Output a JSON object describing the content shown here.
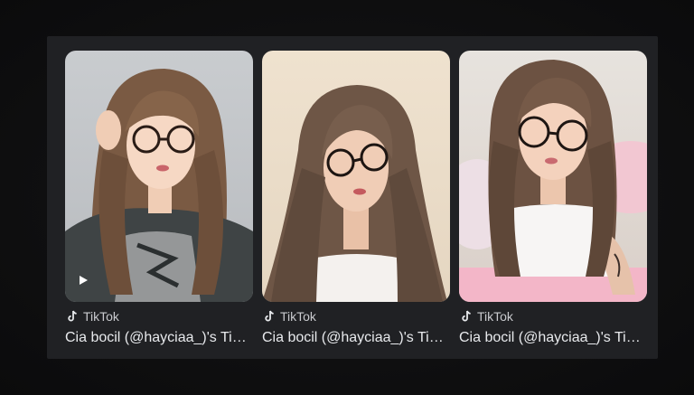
{
  "results": [
    {
      "source": "TikTok",
      "title": "Cia bocil (@hayciaa_)'s TikTok",
      "has_play_icon": true
    },
    {
      "source": "TikTok",
      "title": "Cia bocil (@hayciaa_)'s TikTok",
      "has_play_icon": false
    },
    {
      "source": "TikTok",
      "title": "Cia bocil (@hayciaa_)'s TikTok",
      "has_play_icon": false
    }
  ],
  "colors": {
    "page_bg": "#0f0f10",
    "panel_bg": "#202124",
    "title_text": "#e8eaed",
    "source_text": "#c9cace"
  }
}
